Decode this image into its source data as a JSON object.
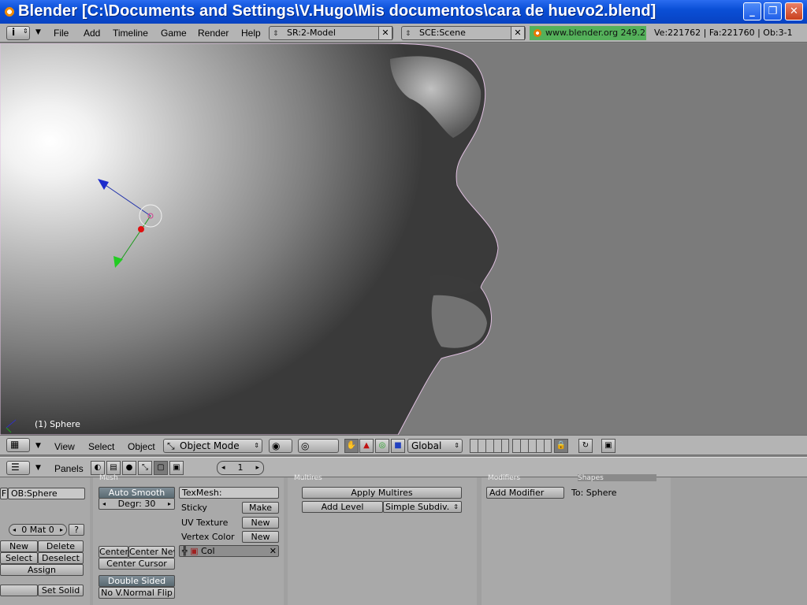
{
  "window": {
    "title": "Blender [C:\\Documents and Settings\\V.Hugo\\Mis documentos\\cara de huevo2.blend]",
    "minimize": "_",
    "maximize": "❐",
    "close": "✕"
  },
  "info_header": {
    "menus": [
      "File",
      "Add",
      "Timeline",
      "Game",
      "Render",
      "Help"
    ],
    "screen": "SR:2-Model",
    "scene": "SCE:Scene",
    "link": "www.blender.org 249.2",
    "stats": "Ve:221762 | Fa:221760 | Ob:3-1",
    "x_label": "✕"
  },
  "viewport": {
    "object_label": "(1) Sphere"
  },
  "view3d_header": {
    "menus": [
      "View",
      "Select",
      "Object"
    ],
    "mode": "Object Mode",
    "orientation": "Global"
  },
  "buttons_header": {
    "panels_label": "Panels",
    "frame": "1"
  },
  "link_materials": {
    "ob_name": "OB:Sphere",
    "f_label": "F",
    "mat": "0 Mat 0",
    "question": "?",
    "new": "New",
    "delete": "Delete",
    "select": "Select",
    "deselect": "Deselect",
    "assign": "Assign",
    "set_solid": "Set Solid"
  },
  "mesh": {
    "tab": "Mesh",
    "auto_smooth": "Auto Smooth",
    "degr": "Degr: 30",
    "center": "Center",
    "center_new": "Center New",
    "center_cursor": "Center Cursor",
    "double_sided": "Double Sided",
    "no_vnormal_flip": "No V.Normal Flip",
    "texmesh": "TexMesh:",
    "sticky": "Sticky",
    "make": "Make",
    "uv_texture": "UV Texture",
    "vertex_color": "Vertex Color",
    "new": "New",
    "col": "Col"
  },
  "multires": {
    "tab": "Multires",
    "apply": "Apply Multires",
    "add_level": "Add Level",
    "subdiv": "Simple Subdiv."
  },
  "modifiers": {
    "tab": "Modifiers",
    "tab2": "Shapes",
    "add_modifier": "Add Modifier",
    "to": "To: Sphere"
  },
  "colors": {
    "title_blue": "#0a4fd6",
    "header_gray": "#b4b4b4",
    "link_green": "#54b05a",
    "panel_gray": "#a9a9a9"
  }
}
